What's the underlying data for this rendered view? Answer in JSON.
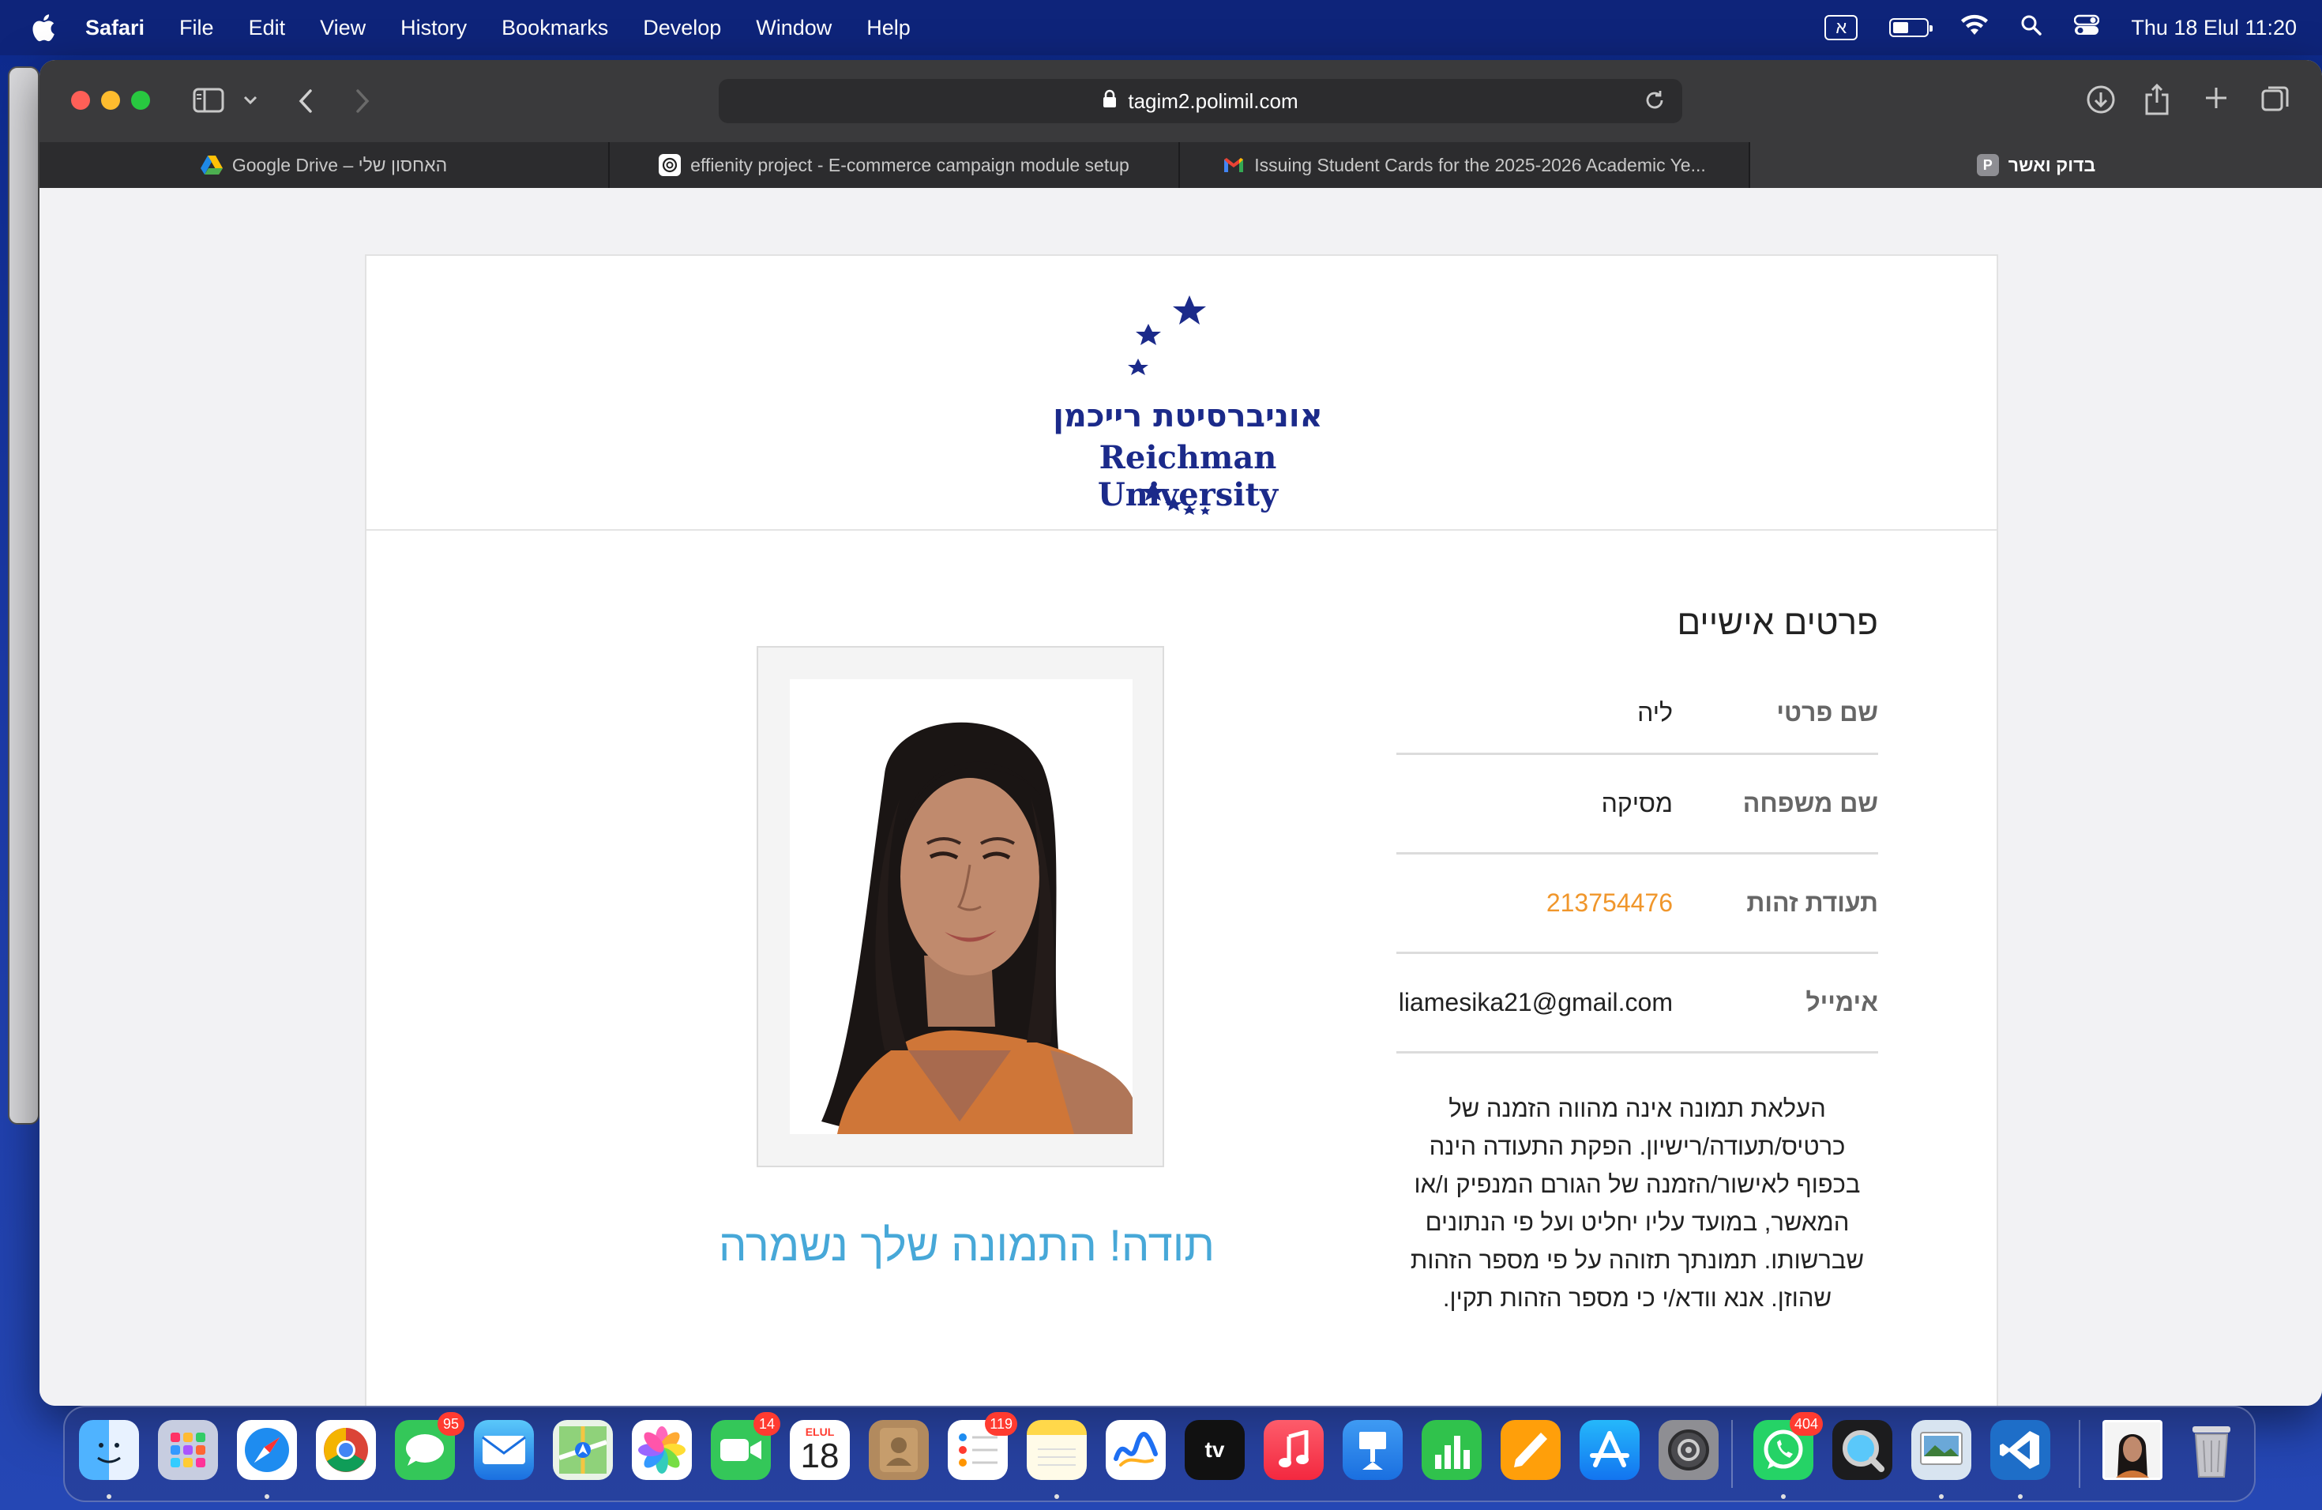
{
  "menubar": {
    "app_name": "Safari",
    "items": [
      "File",
      "Edit",
      "View",
      "History",
      "Bookmarks",
      "Develop",
      "Window",
      "Help"
    ],
    "input_source": "א",
    "clock": "Thu 18 Elul  11:20"
  },
  "browser": {
    "url": "tagim2.polimil.com",
    "tabs": [
      {
        "title": "Google Drive – האחסון שלי",
        "icon": "google-drive-icon"
      },
      {
        "title": "effienity project - E-commerce campaign module setup",
        "icon": "openai-icon"
      },
      {
        "title": "Issuing Student Cards for the 2025-2026 Academic Ye...",
        "icon": "gmail-icon"
      },
      {
        "title": "בדוק ואשר",
        "icon": "p-letter-icon",
        "favicon_letter": "P",
        "active": true
      }
    ]
  },
  "page": {
    "logo": {
      "hebrew": "אוניברסיטת רייכמן",
      "english": "Reichman University",
      "color": "#1b2a8a"
    },
    "details": {
      "title": "פרטים אישיים",
      "fields": [
        {
          "label": "שם פרטי",
          "value": "ליה"
        },
        {
          "label": "שם משפחה",
          "value": "מסיקה"
        },
        {
          "label": "תעודת זהות",
          "value": "213754476"
        },
        {
          "label": "אימייל",
          "value": "liamesika21@gmail.com"
        }
      ],
      "notice_lines": [
        "העלאת תמונה אינה מהווה הזמנה של",
        "כרטיס/תעודה/רישיון. הפקת התעודה הינה",
        "בכפוף לאישור/הזמנה של הגורם המנפיק ו/או",
        "המאשר, במועד עליו יחליט ועל פי הנתונים",
        "שברשותו. תמונתך תזוהה על פי מספר הזהות",
        "שהוזן. אנא וודא/י כי מספר הזהות תקין."
      ]
    },
    "photo_alt": "uploaded profile photo",
    "thanks": "תודה! התמונה שלך נשמרה",
    "accent_color": "#47a8d8",
    "id_color": "#f0962b"
  },
  "dock": {
    "badges": {
      "messages": "95",
      "facetime": "14",
      "reminders": "119",
      "whatsapp": "404"
    },
    "calendar": {
      "month": "ELUL",
      "day": "18"
    }
  }
}
